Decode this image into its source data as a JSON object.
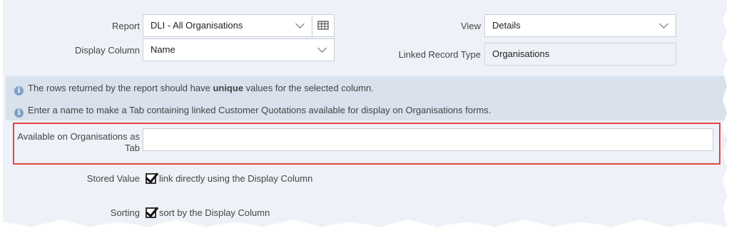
{
  "form": {
    "report": {
      "label": "Report",
      "value": "DLI - All Organisations"
    },
    "display_column": {
      "label": "Display Column",
      "value": "Name"
    },
    "view": {
      "label": "View",
      "value": "Details"
    },
    "linked_record_type": {
      "label": "Linked Record Type",
      "value": "Organisations"
    }
  },
  "info": {
    "line1_pre": "The rows returned by the report should have ",
    "line1_bold": "unique",
    "line1_post": " values for the selected column.",
    "line2": "Enter a name to make a Tab containing linked Customer Quotations available for display on Organisations forms."
  },
  "tab_field": {
    "label_line1": "Available on Organisations as",
    "label_line2": "Tab",
    "value": ""
  },
  "stored_value": {
    "label": "Stored Value",
    "checkbox_text": "link directly using the Display Column",
    "checked": true
  },
  "sorting": {
    "label": "Sorting",
    "checkbox_text": "sort by the Display Column",
    "checked": true
  },
  "colors": {
    "highlight": "#e2463f",
    "info_bg": "#d8e1ec",
    "panel_bg": "#eef2f8"
  },
  "icons": [
    "chevron-down-icon",
    "grid-table-icon",
    "info-icon",
    "checkbox-checked-icon"
  ]
}
